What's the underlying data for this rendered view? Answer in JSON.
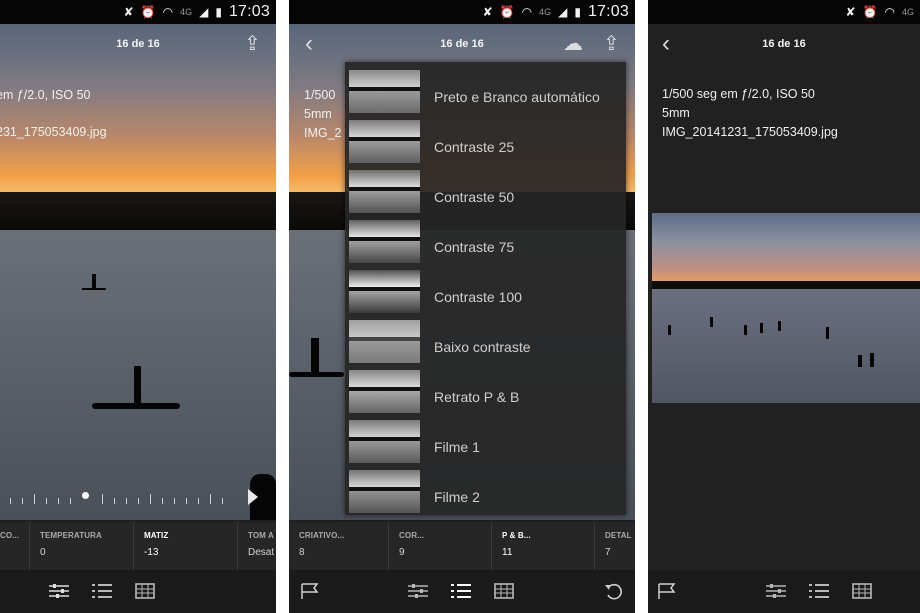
{
  "status": {
    "time": "17:03",
    "network": "4G"
  },
  "counter": "16 de 16",
  "info": {
    "line1": "1/500 seg em ƒ/2.0, ISO 50",
    "line2": "5mm",
    "line3": "IMG_20141231_175053409.jpg"
  },
  "p1_info": {
    "line1": "em ƒ/2.0, ISO 50",
    "line2": "231_175053409.jpg"
  },
  "p2_info": {
    "line1": "1/500",
    "line2": "5mm",
    "line3": "IMG_2"
  },
  "p1_adjustments": [
    {
      "label": "CO...",
      "value": ""
    },
    {
      "label": "TEMPERATURA",
      "value": "0"
    },
    {
      "label": "MATIZ",
      "value": "-13"
    },
    {
      "label": "TOM A",
      "value": "Desat"
    }
  ],
  "p2_adjustments": [
    {
      "label": "CRIATIVO...",
      "value": "8"
    },
    {
      "label": "COR...",
      "value": "9"
    },
    {
      "label": "P & B...",
      "value": "11"
    },
    {
      "label": "DETAL",
      "value": "7"
    }
  ],
  "presets": [
    "Preto e Branco automático",
    "Contraste 25",
    "Contraste 50",
    "Contraste 75",
    "Contraste 100",
    "Baixo contraste",
    "Retrato P & B",
    "Filme 1",
    "Filme 2"
  ],
  "colors": {
    "sky_top": "#5c6c82",
    "sunset": "#f0a050",
    "water": "#5f6672",
    "panel": "#262626"
  }
}
